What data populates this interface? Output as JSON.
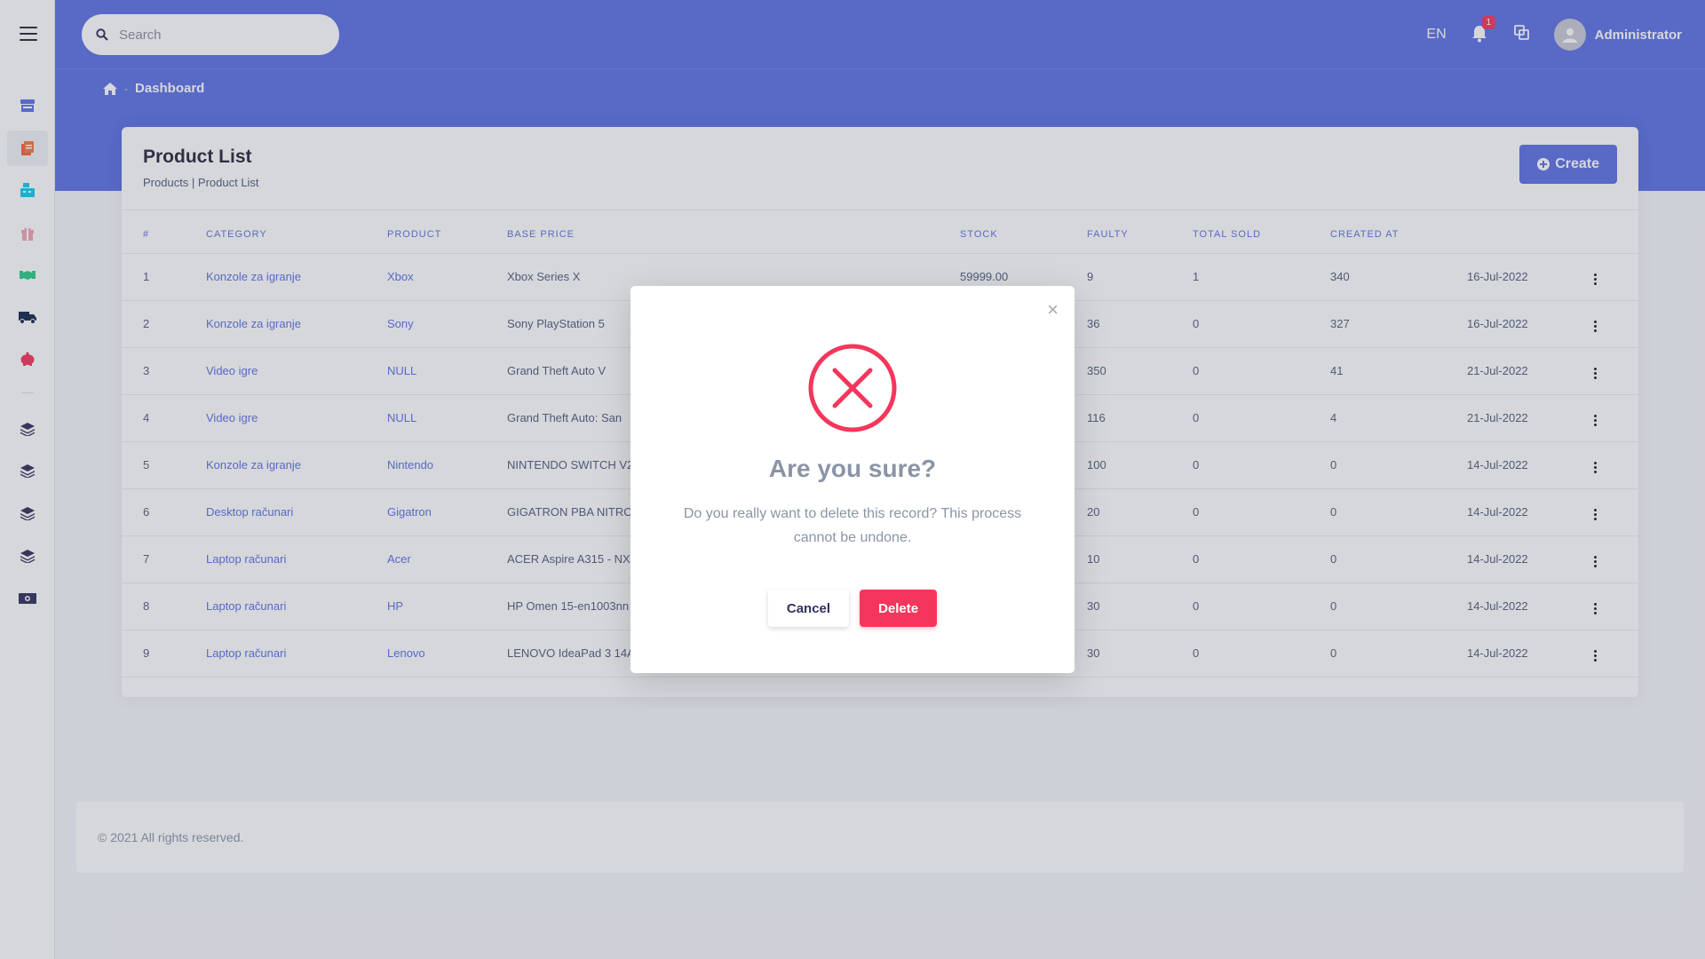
{
  "search": {
    "placeholder": "Search"
  },
  "header": {
    "lang": "EN",
    "notification_count": "1",
    "user_name": "Administrator"
  },
  "breadcrumb": {
    "current": "Dashboard"
  },
  "card": {
    "title": "Product List",
    "subtitle": "Products | Product List",
    "create_label": "Create"
  },
  "table": {
    "headers": [
      "#",
      "CATEGORY",
      "PRODUCT",
      "BASE PRICE",
      "STOCK",
      "FAULTY",
      "TOTAL SOLD",
      "CREATED AT"
    ],
    "rows": [
      {
        "num": "1",
        "category": "Konzole za igranje",
        "product": "Xbox",
        "name": "Xbox Series X",
        "price": "59999.00",
        "stock": "9",
        "faulty": "1",
        "sold": "340",
        "created": "16-Jul-2022"
      },
      {
        "num": "2",
        "category": "Konzole za igranje",
        "product": "Sony",
        "name": "Sony PlayStation 5",
        "price": "",
        "stock": "36",
        "faulty": "0",
        "sold": "327",
        "created": "16-Jul-2022"
      },
      {
        "num": "3",
        "category": "Video igre",
        "product": "NULL",
        "name": "Grand Theft Auto V",
        "price": "",
        "stock": "350",
        "faulty": "0",
        "sold": "41",
        "created": "21-Jul-2022"
      },
      {
        "num": "4",
        "category": "Video igre",
        "product": "NULL",
        "name": "Grand Theft Auto: San",
        "price": "",
        "stock": "116",
        "faulty": "0",
        "sold": "4",
        "created": "21-Jul-2022"
      },
      {
        "num": "5",
        "category": "Konzole za igranje",
        "product": "Nintendo",
        "name": "NINTENDO SWITCH V2",
        "price": "",
        "stock": "100",
        "faulty": "0",
        "sold": "0",
        "created": "14-Jul-2022"
      },
      {
        "num": "6",
        "category": "Desktop računari",
        "product": "Gigatron",
        "name": "GIGATRON PBA NITRO",
        "price": "",
        "stock": "20",
        "faulty": "0",
        "sold": "0",
        "created": "14-Jul-2022"
      },
      {
        "num": "7",
        "category": "Laptop računari",
        "product": "Acer",
        "name": "ACER Aspire A315 - NX.",
        "price": "",
        "stock": "10",
        "faulty": "0",
        "sold": "0",
        "created": "14-Jul-2022"
      },
      {
        "num": "8",
        "category": "Laptop računari",
        "product": "HP",
        "name": "HP Omen 15-en1003nn",
        "price": "",
        "stock": "30",
        "faulty": "0",
        "sold": "0",
        "created": "14-Jul-2022"
      },
      {
        "num": "9",
        "category": "Laptop računari",
        "product": "Lenovo",
        "name": "LENOVO IdeaPad 3 14A",
        "price": "",
        "stock": "30",
        "faulty": "0",
        "sold": "0",
        "created": "14-Jul-2022"
      }
    ]
  },
  "footer": {
    "text": "© 2021 All rights reserved."
  },
  "modal": {
    "title": "Are you sure?",
    "text": "Do you really want to delete this record? This process cannot be undone.",
    "cancel_label": "Cancel",
    "delete_label": "Delete",
    "close_symbol": "×"
  },
  "colors": {
    "primary": "#5e72e4",
    "danger": "#f5365c"
  },
  "sidebar_icons": [
    "store-icon",
    "document-icon",
    "cash-register-icon",
    "gift-icon",
    "handshake-icon",
    "truck-icon",
    "piggy-bank-icon",
    "layers-icon",
    "layers-icon",
    "layers-icon",
    "layers-icon",
    "money-bill-icon"
  ]
}
